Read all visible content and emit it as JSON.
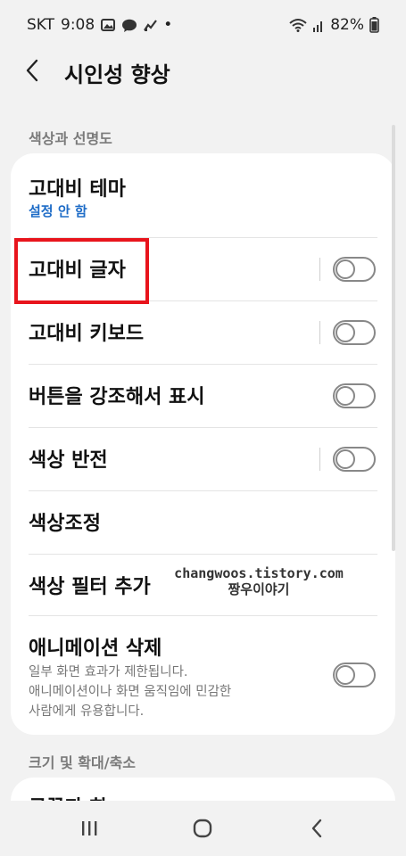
{
  "status_bar": {
    "carrier": "SKT",
    "time": "9:08",
    "battery": "82%",
    "left_icons": [
      "gallery-icon",
      "kakaotalk-icon",
      "chart-icon"
    ],
    "right_icons": [
      "wifi-icon",
      "signal-icon",
      "battery-icon"
    ],
    "dot": "•"
  },
  "header": {
    "title": "시인성 향상"
  },
  "sections": [
    {
      "label": "색상과 선명도"
    },
    {
      "label": "크기 및 확대/축소"
    }
  ],
  "items": [
    {
      "title": "고대비 테마",
      "subtitle": "설정 안 함"
    },
    {
      "title": "고대비 글자",
      "toggle": false
    },
    {
      "title": "고대비 키보드",
      "toggle": false
    },
    {
      "title": "버튼을 강조해서 표시",
      "toggle": false
    },
    {
      "title": "색상 반전",
      "toggle": false
    },
    {
      "title": "색상조정"
    },
    {
      "title": "색상 필터 추가"
    },
    {
      "title": "애니메이션 삭제",
      "desc_lines": [
        "일부 화면 효과가 제한됩니다.",
        "애니메이션이나 화면 움직임에 민감한",
        "사람에게 유용합니다."
      ],
      "toggle": false
    }
  ],
  "next_card_partial_title": "글꼴과 화",
  "watermark": {
    "line1": "changwoos.tistory.com",
    "line2": "짱우이야기"
  },
  "colors": {
    "accent": "#1e6cc7",
    "highlight": "#e8141c",
    "background": "#f2f2f2"
  },
  "navbar_icons": [
    "recent-apps-icon",
    "home-icon",
    "back-icon"
  ]
}
